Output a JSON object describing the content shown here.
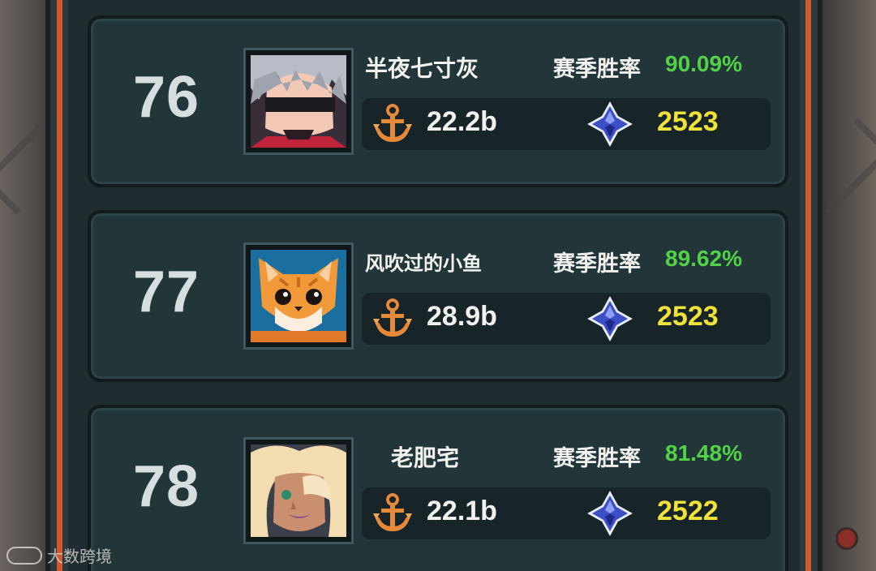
{
  "rows": [
    {
      "rank": "76",
      "name": "半夜七寸灰",
      "winrate_label": "赛季胜率",
      "winrate": "90.09%",
      "power": "22.2b",
      "score": "2523",
      "avatar": "masked-silver-hair-avatar"
    },
    {
      "rank": "77",
      "name": "风吹过的小鱼",
      "winrate_label": "赛季胜率",
      "winrate": "89.62%",
      "power": "28.9b",
      "score": "2523",
      "avatar": "orange-cat-avatar"
    },
    {
      "rank": "78",
      "name": "老肥宅",
      "winrate_label": "赛季胜率",
      "winrate": "81.48%",
      "power": "22.1b",
      "score": "2522",
      "avatar": "blonde-eyepatch-avatar"
    }
  ],
  "icons": {
    "power": "anchor-icon",
    "score": "blue-crystal-icon"
  },
  "colors": {
    "winrate": "#52d246",
    "score": "#f1e23a",
    "frame_orange": "#d3592c"
  },
  "watermark": "大数跨境"
}
